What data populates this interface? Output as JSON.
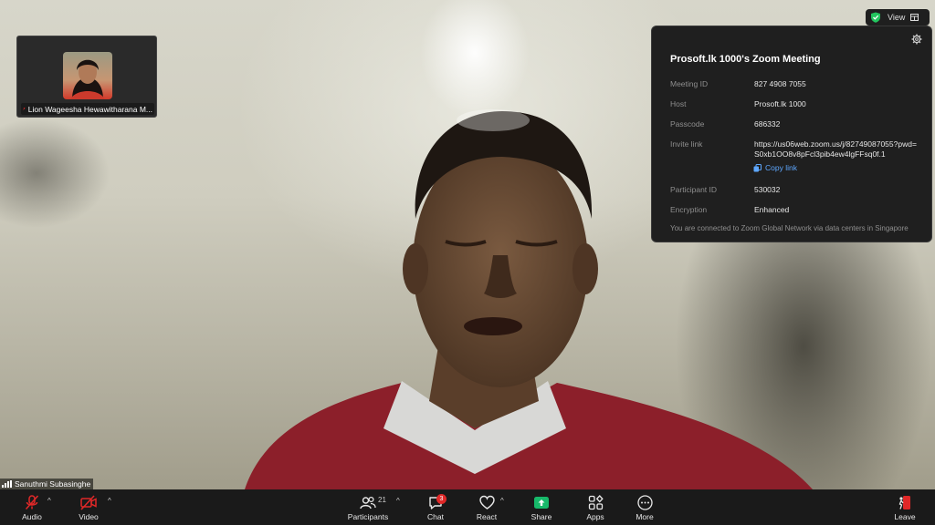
{
  "thumbnail": {
    "name": "Lion Wageesha Hewawitharana M..."
  },
  "view_button": {
    "label": "View"
  },
  "meeting_info": {
    "title": "Prosoft.lk 1000's Zoom Meeting",
    "rows": [
      {
        "label": "Meeting ID",
        "value": "827 4908 7055"
      },
      {
        "label": "Host",
        "value": "Prosoft.lk 1000"
      },
      {
        "label": "Passcode",
        "value": "686332"
      },
      {
        "label": "Invite link",
        "value": "https://us06web.zoom.us/j/82749087055?pwd=S0xb1OO8v8pFcl3pib4ew4lgFFsq0f.1"
      },
      {
        "label": "Participant ID",
        "value": "530032"
      },
      {
        "label": "Encryption",
        "value": "Enhanced"
      }
    ],
    "copy_link_label": "Copy link",
    "footer": "You are connected to Zoom Global Network via data centers in Singapore"
  },
  "self_view": {
    "name": "Sanuthmi Subasinghe"
  },
  "toolbar": {
    "audio": {
      "label": "Audio"
    },
    "video": {
      "label": "Video"
    },
    "participants": {
      "label": "Participants",
      "count": "21"
    },
    "chat": {
      "label": "Chat",
      "badge": "3"
    },
    "react": {
      "label": "React"
    },
    "share": {
      "label": "Share"
    },
    "apps": {
      "label": "Apps"
    },
    "more": {
      "label": "More"
    },
    "leave": {
      "label": "Leave"
    }
  },
  "colors": {
    "toolbar_bg": "#1a1a1a",
    "panel_bg": "#1f1f1f",
    "share_green": "#17b96a",
    "muted_red": "#e02828",
    "link_blue": "#5ea7ff",
    "shield_green": "#22c55e"
  },
  "icons": {
    "audio": "microphone-muted-icon",
    "video": "camera-off-icon",
    "participants": "people-icon",
    "chat": "chat-bubble-icon",
    "react": "heart-icon",
    "share": "share-screen-icon",
    "apps": "apps-grid-icon",
    "more": "more-dots-icon",
    "leave": "leave-door-icon",
    "settings": "gear-icon",
    "security": "shield-check-icon"
  }
}
